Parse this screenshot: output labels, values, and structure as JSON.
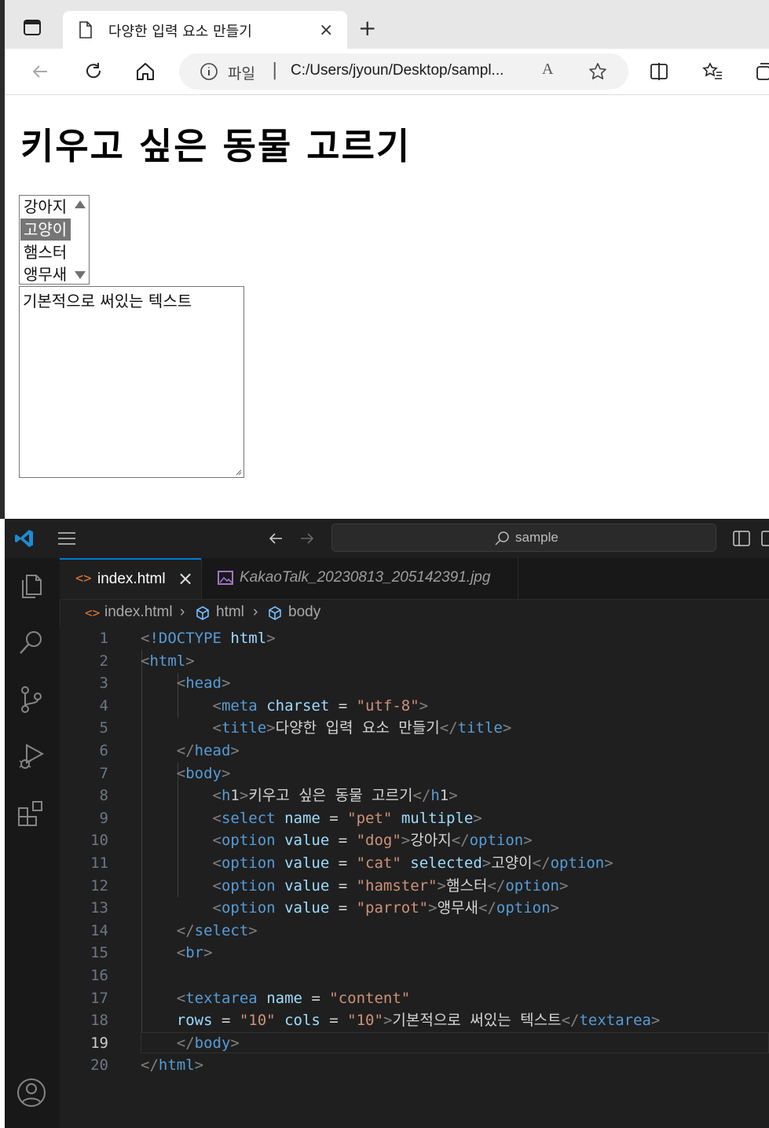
{
  "browser": {
    "tab_title": "다양한 입력 요소 만들기",
    "tab_close": "×",
    "new_tab": "+",
    "address_prefix": "파일",
    "address_separator": "|",
    "url": "C:/Users/jyoun/Desktop/sampl...",
    "read_aloud": "A",
    "icons": [
      "tab-actions-icon",
      "document-icon",
      "back-icon",
      "refresh-icon",
      "home-icon",
      "info-icon",
      "read-aloud-icon",
      "favorite-star-icon",
      "split-screen-icon",
      "favorites-icon",
      "collections-icon"
    ]
  },
  "page": {
    "heading": "키우고 싶은 동물 고르기",
    "options": [
      "강아지",
      "고양이",
      "햄스터",
      "앵무새"
    ],
    "selected_index": 1,
    "textarea_text": "기본적으로 써있는 텍스트"
  },
  "vscode": {
    "search_text": "sample",
    "tab_active": "index.html",
    "tab_close": "×",
    "tab_other": "KakaoTalk_20230813_205142391.jpg",
    "breadcrumb": [
      "index.html",
      "html",
      "body"
    ],
    "current_line": 19,
    "colors": {
      "accent": "#0078d4",
      "tag": "#569cd6",
      "attr": "#9cdcfe",
      "string": "#ce9178"
    },
    "code_lines": [
      {
        "n": "1",
        "text": "<!DOCTYPE html>"
      },
      {
        "n": "2",
        "text": "<html>"
      },
      {
        "n": "3",
        "text": "    <head>"
      },
      {
        "n": "4",
        "text": "        <meta charset = \"utf-8\">"
      },
      {
        "n": "5",
        "text": "        <title>다양한 입력 요소 만들기</title>"
      },
      {
        "n": "6",
        "text": "    </head>"
      },
      {
        "n": "7",
        "text": "    <body>"
      },
      {
        "n": "8",
        "text": "        <h1>키우고 싶은 동물 고르기</h1>"
      },
      {
        "n": "9",
        "text": "        <select name = \"pet\" multiple>"
      },
      {
        "n": "10",
        "text": "        <option value = \"dog\">강아지</option>"
      },
      {
        "n": "11",
        "text": "        <option value = \"cat\" selected>고양이</option>"
      },
      {
        "n": "12",
        "text": "        <option value = \"hamster\">햄스터</option>"
      },
      {
        "n": "13",
        "text": "        <option value = \"parrot\">앵무새</option>"
      },
      {
        "n": "14",
        "text": "    </select>"
      },
      {
        "n": "15",
        "text": "    <br>"
      },
      {
        "n": "16",
        "text": ""
      },
      {
        "n": "17",
        "text": "    <textarea name = \"content\""
      },
      {
        "n": "18",
        "text": "    rows = \"10\" cols = \"10\">기본적으로 써있는 텍스트</textarea>"
      },
      {
        "n": "19",
        "text": "    </body>"
      },
      {
        "n": "20",
        "text": "</html>"
      }
    ]
  }
}
